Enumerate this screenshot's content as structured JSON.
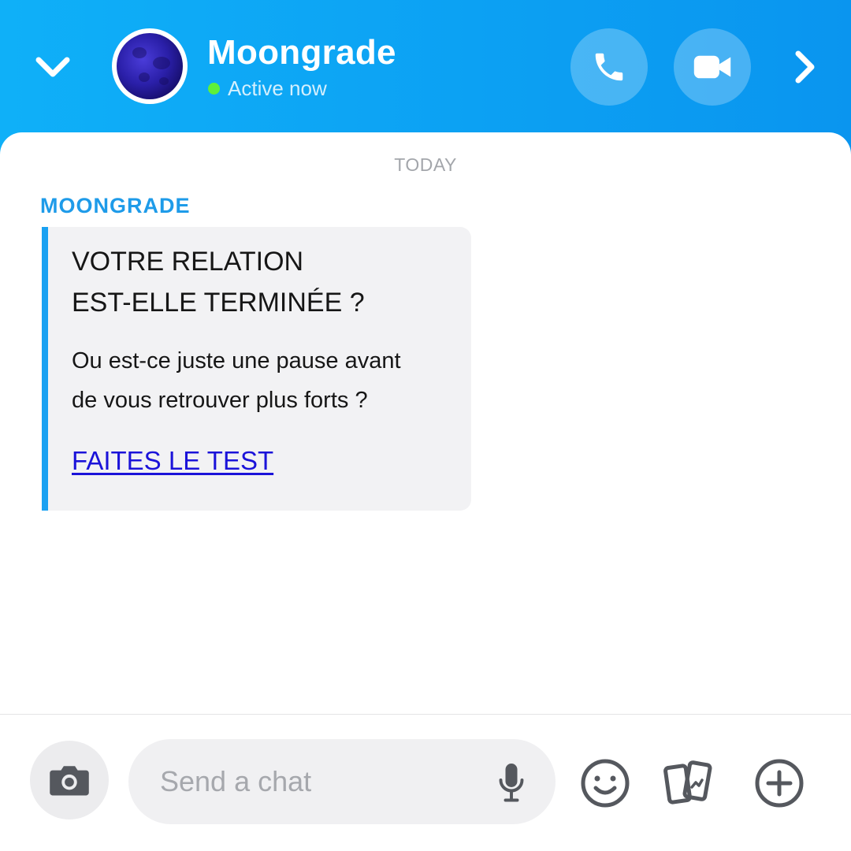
{
  "header": {
    "contact_name": "Moongrade",
    "status": "Active now",
    "colors": {
      "gradient_start": "#0fb0f8",
      "gradient_end": "#0a95ef",
      "status_dot": "#5ef03a"
    },
    "icons": {
      "back": "chevron-down-icon",
      "call": "phone-icon",
      "video": "video-camera-icon",
      "forward": "chevron-right-icon"
    }
  },
  "chat": {
    "date_label": "TODAY",
    "sender": "MOONGRADE",
    "message": {
      "title_line1": "VOTRE RELATION",
      "title_line2": "EST-ELLE TERMINÉE ?",
      "body_line1": "Ou est-ce juste une pause avant",
      "body_line2": "de vous retrouver plus forts ?",
      "link": "FAITES LE TEST"
    },
    "colors": {
      "accent": "#1aa1f2",
      "link": "#1b13d9",
      "bubble_bg": "#f2f2f4"
    }
  },
  "composer": {
    "placeholder": "Send a chat",
    "icons": {
      "camera": "camera-icon",
      "mic": "microphone-icon",
      "emoji": "smiley-icon",
      "stickers": "cards-icon",
      "more": "plus-circle-icon"
    }
  }
}
